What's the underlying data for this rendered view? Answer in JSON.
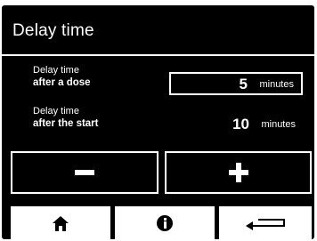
{
  "screen": {
    "title": "Delay time"
  },
  "settings": {
    "dose": {
      "label_line1": "Delay time",
      "label_line2": "after a dose",
      "value": "5",
      "unit": "minutes",
      "selected": true
    },
    "start": {
      "label_line1": "Delay time",
      "label_line2": "after the start",
      "value": "10",
      "unit": "minutes",
      "selected": false
    }
  },
  "controls": {
    "decrement_icon": "minus-icon",
    "increment_icon": "plus-icon"
  },
  "nav": {
    "home_icon": "home-icon",
    "info_icon": "info-icon",
    "back_icon": "back-icon"
  },
  "colors": {
    "screen_background": "#000000",
    "foreground": "#ffffff"
  }
}
